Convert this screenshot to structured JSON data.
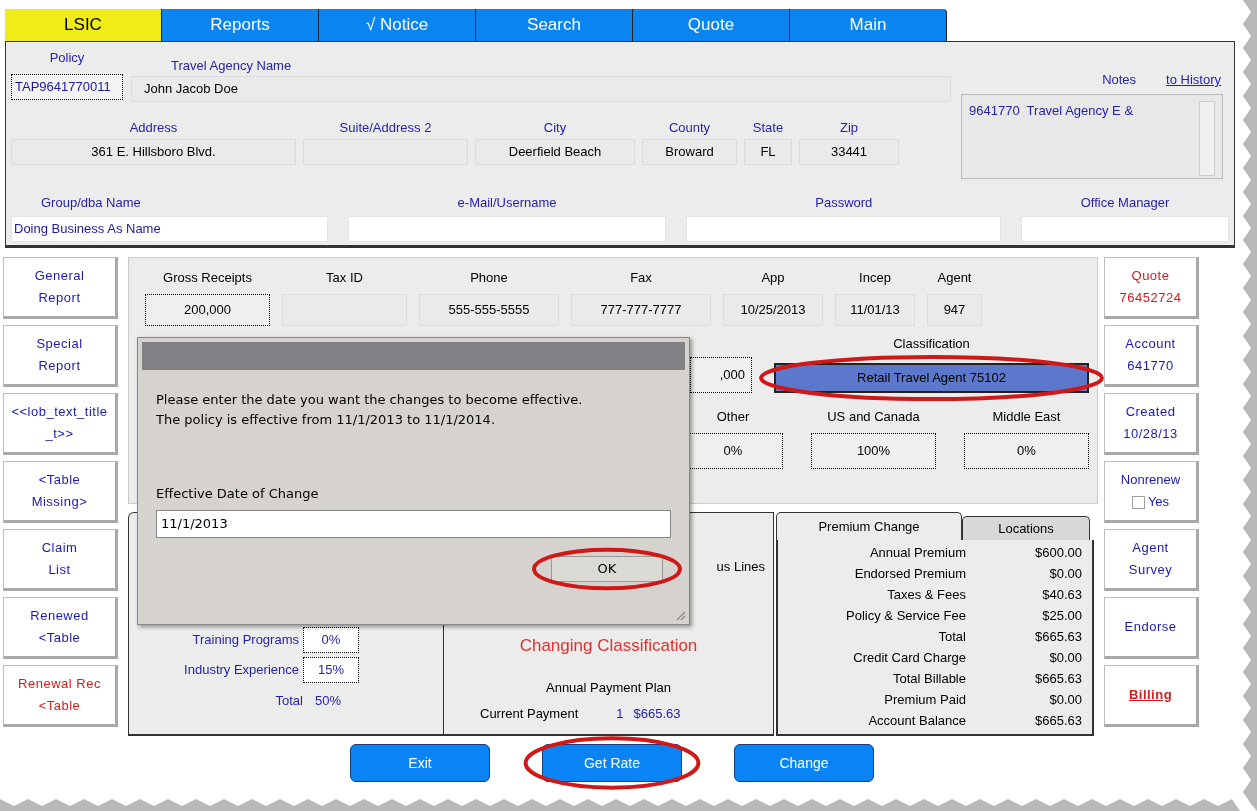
{
  "tabs": [
    {
      "label": "LSIC",
      "selected": true
    },
    {
      "label": "Reports",
      "selected": false
    },
    {
      "label": "√ Notice",
      "selected": false
    },
    {
      "label": "Search",
      "selected": false
    },
    {
      "label": "Quote",
      "selected": false
    },
    {
      "label": "Main",
      "selected": false
    }
  ],
  "header": {
    "policy": {
      "label": "Policy",
      "value": "TAP9641770011"
    },
    "agency": {
      "label": "Travel Agency Name",
      "value": "John Jacob Doe"
    },
    "notes": {
      "label": "Notes",
      "link": "to History",
      "text": "9641770  Travel Agency E &"
    },
    "address": [
      {
        "label": "Address",
        "value": "361 E. Hillsboro Blvd."
      },
      {
        "label": "Suite/Address 2"
      },
      {
        "label": "City",
        "value": "Deerfield Beach"
      },
      {
        "label": "County",
        "value": "Broward"
      },
      {
        "label": "State",
        "value": "FL"
      },
      {
        "label": "Zip",
        "value": "33441"
      }
    ],
    "contact": [
      {
        "label": "Group/dba Name",
        "value": "Doing Business As Name"
      },
      {
        "label": "e-Mail/Username"
      },
      {
        "label": "Password"
      },
      {
        "label": "Office Manager"
      }
    ]
  },
  "summary": [
    {
      "label": "Gross Receipts",
      "value": "200,000",
      "focused": true
    },
    {
      "label": "Tax ID",
      "focused": false
    },
    {
      "label": "Phone",
      "value": "555-555-5555",
      "focused": false
    },
    {
      "label": "Fax",
      "value": "777-777-7777",
      "focused": false
    },
    {
      "label": "App",
      "value": "10/25/2013",
      "focused": false
    },
    {
      "label": "Incep",
      "value": "11/01/13",
      "focused": false
    },
    {
      "label": "Agent",
      "value": "947",
      "focused": false
    }
  ],
  "partial_field": ",000",
  "classification": {
    "label": "Classification",
    "value": "Retail Travel Agent 75102",
    "highlighted": true
  },
  "regions": [
    {
      "label": "Other",
      "value": "0%"
    },
    {
      "label": "US and Canada",
      "value": "100%"
    },
    {
      "label": "Middle East",
      "value": "0%"
    }
  ],
  "left_nav": [
    {
      "lines": [
        "General",
        "Report"
      ],
      "color": "#1a1ab0"
    },
    {
      "lines": [
        "Special",
        "Report"
      ],
      "color": "#1a1ab0"
    },
    {
      "lines": [
        "<<lob_text_title",
        "_t>>"
      ],
      "color": "#1a1ab0"
    },
    {
      "lines": [
        "<Table",
        "Missing>"
      ],
      "color": "#1a1ab0"
    },
    {
      "lines": [
        "Claim",
        "List"
      ],
      "color": "#1a1ab0"
    },
    {
      "lines": [
        "Renewed",
        "<Table"
      ],
      "color": "#1a1ab0"
    },
    {
      "lines": [
        "Renewal Rec",
        "<Table"
      ],
      "color": "#cc2020"
    }
  ],
  "right_nav": [
    {
      "kind": "button",
      "lines": [
        "Quote",
        "76452724"
      ],
      "color": "#cc2020"
    },
    {
      "kind": "button",
      "lines": [
        "Account",
        "641770"
      ],
      "color": "#1a1ab0"
    },
    {
      "kind": "button",
      "lines": [
        "Created",
        "10/28/13"
      ],
      "color": "#1a1ab0"
    },
    {
      "kind": "checkbox",
      "lines": [
        "Nonrenew",
        "Yes"
      ],
      "color": "#1a1ab0",
      "checked": false
    },
    {
      "kind": "button",
      "lines": [
        "Agent",
        "Survey"
      ],
      "color": "#1a1ab0"
    },
    {
      "kind": "button",
      "lines": [
        "Endorse"
      ],
      "color": "#1a1ab0"
    },
    {
      "kind": "link",
      "lines": [
        "Billing"
      ],
      "color": "#cc2020"
    }
  ],
  "rating": [
    {
      "label": "Training Programs",
      "value": "0%"
    },
    {
      "label": "Industry Experience",
      "value": "15%"
    }
  ],
  "rating_total": {
    "label": "Total",
    "value": "50%"
  },
  "plan": {
    "partial_label": "us Lines",
    "status": "Changing Classification",
    "title": "Annual Payment Plan",
    "payment_label": "Current Payment",
    "payment_number": "1",
    "payment_amount": "$665.63"
  },
  "premium": {
    "tabs": [
      {
        "label": "Premium Change",
        "selected": true
      },
      {
        "label": "Locations",
        "selected": false
      }
    ],
    "rows": [
      {
        "label": "Annual Premium",
        "value": "$600.00"
      },
      {
        "label": "Endorsed Premium",
        "value": "$0.00"
      },
      {
        "label": "Taxes & Fees",
        "value": "$40.63"
      },
      {
        "label": "Policy & Service Fee",
        "value": "$25.00"
      },
      {
        "label": "Total",
        "value": "$665.63"
      },
      {
        "label": "Credit Card Charge",
        "value": "$0.00"
      },
      {
        "label": "Total Billable",
        "value": "$665.63"
      },
      {
        "label": "Premium Paid",
        "value": "$0.00"
      },
      {
        "label": "Account Balance",
        "value": "$665.63"
      }
    ]
  },
  "buttons": [
    {
      "label": "Exit",
      "highlighted": false
    },
    {
      "label": "Get Rate",
      "highlighted": true
    },
    {
      "label": "Change",
      "highlighted": false
    }
  ],
  "dialog": {
    "message": [
      "Please enter the date you want the changes to become effective.",
      "The policy is effective from 11/1/2013 to 11/1/2014."
    ],
    "field_label": "Effective Date of Change",
    "field_value": "11/1/2013",
    "ok": {
      "label": "OK",
      "highlighted": true
    }
  }
}
